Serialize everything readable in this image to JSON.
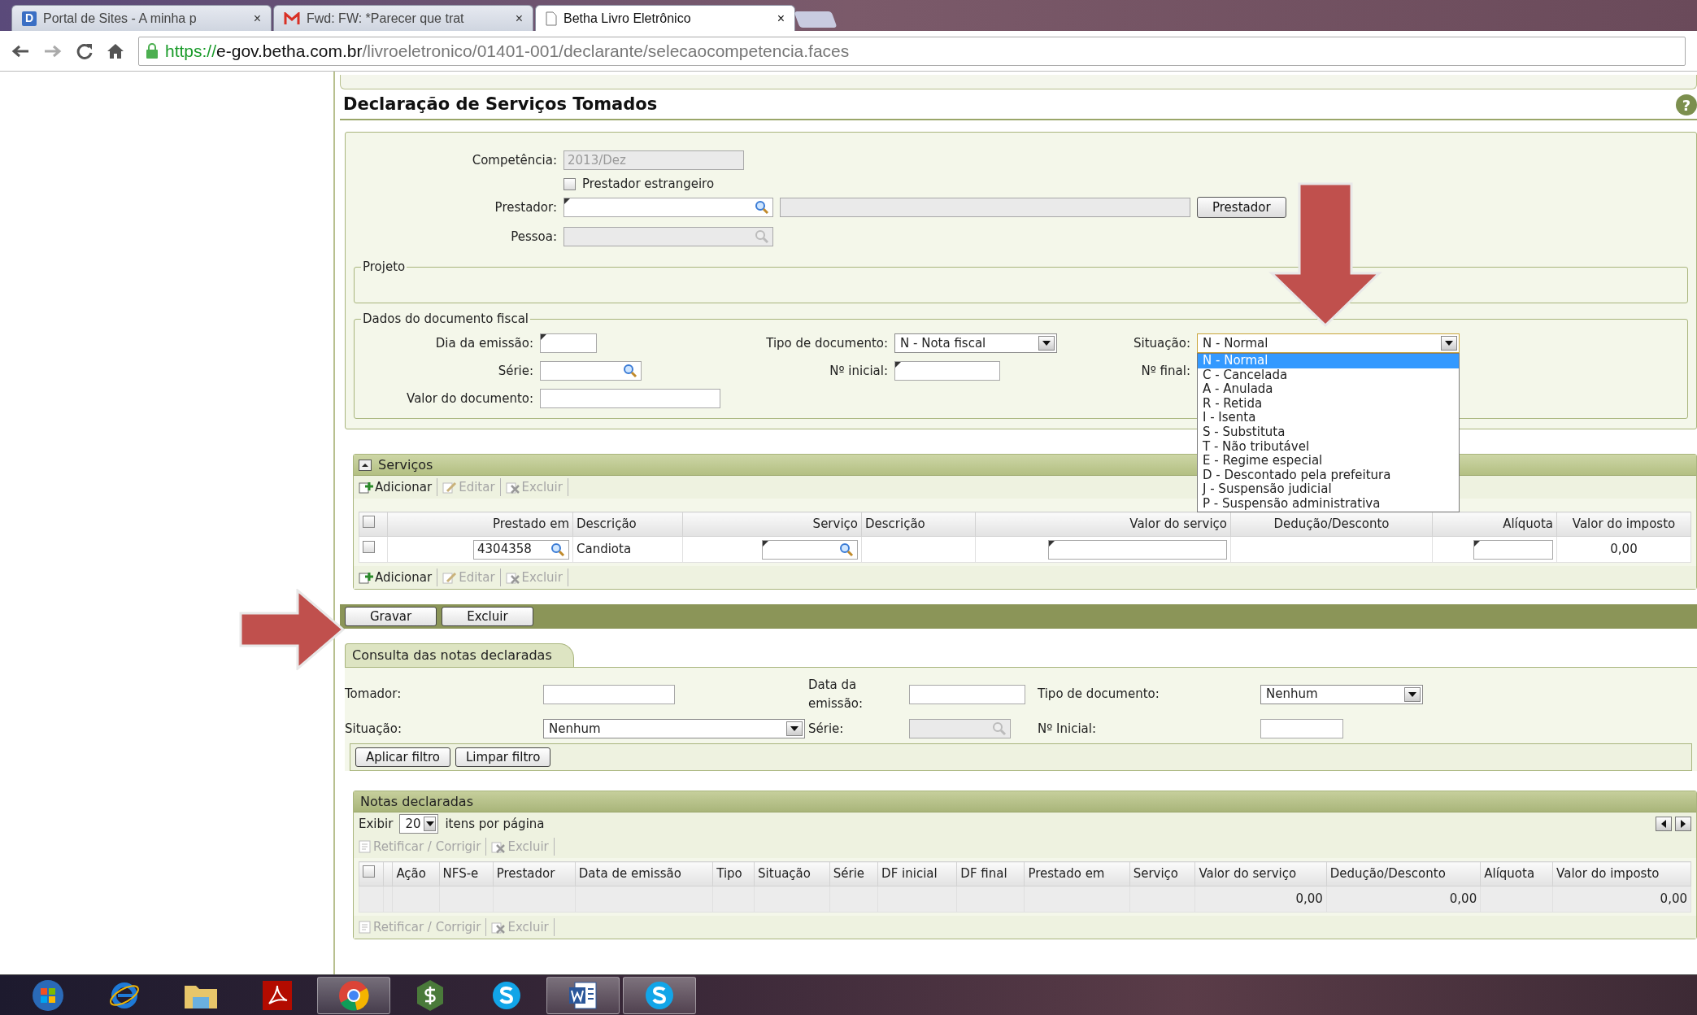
{
  "browser": {
    "tabs": [
      {
        "kind": "portal",
        "badge": "D",
        "title": "Portal de Sites - A minha p",
        "close": "×",
        "selected": false
      },
      {
        "kind": "mail",
        "title": "Fwd: FW: *Parecer que trat",
        "close": "×",
        "selected": false
      },
      {
        "kind": "page",
        "title": "Betha Livro Eletrônico",
        "close": "×",
        "selected": true
      }
    ],
    "url": {
      "scheme": "https://",
      "host": "e-gov.betha.com.br",
      "path": "/livroeletronico/01401-001/declarante/selecaocompetencia.faces"
    }
  },
  "page": {
    "title": "Declaração de Serviços Tomados",
    "help": "?"
  },
  "form": {
    "competencia": {
      "label": "Competência:",
      "value": "2013/Dez",
      "disabled": true
    },
    "estrangeiro": {
      "label": "Prestador estrangeiro",
      "checked": false
    },
    "prestador": {
      "label": "Prestador:",
      "button": "Prestador"
    },
    "pessoa": {
      "label": "Pessoa:",
      "disabled": true
    },
    "projeto": {
      "legend": "Projeto"
    },
    "documento": {
      "legend": "Dados do documento fiscal",
      "dia": {
        "label": "Dia da emissão:"
      },
      "tipo": {
        "label": "Tipo de documento:",
        "value": "N - Nota fiscal"
      },
      "situacao": {
        "label": "Situação:",
        "value": "N - Normal",
        "expanded": true,
        "options": [
          {
            "text": "N - Normal",
            "selected": true
          },
          {
            "text": "C - Cancelada",
            "selected": false
          },
          {
            "text": "A - Anulada",
            "selected": false
          },
          {
            "text": "R - Retida",
            "selected": false
          },
          {
            "text": "I - Isenta",
            "selected": false
          },
          {
            "text": "S - Substituta",
            "selected": false
          },
          {
            "text": "T - Não tributável",
            "selected": false
          },
          {
            "text": "E - Regime especial",
            "selected": false
          },
          {
            "text": "D - Descontado pela prefeitura",
            "selected": false
          },
          {
            "text": "J - Suspensão judicial",
            "selected": false
          },
          {
            "text": "P - Suspensão administrativa",
            "selected": false
          }
        ]
      },
      "serie": {
        "label": "Série:"
      },
      "inicial": {
        "label": "Nº inicial:"
      },
      "final": {
        "label": "Nº final:"
      },
      "valor": {
        "label": "Valor do documento:"
      }
    }
  },
  "servicos": {
    "title": "Serviços",
    "all_checked": false,
    "toolbar": [
      {
        "kind": "add",
        "label": "Adicionar",
        "disabled": false
      },
      {
        "kind": "edit",
        "label": "Editar",
        "disabled": true
      },
      {
        "kind": "delete",
        "label": "Excluir",
        "disabled": true
      }
    ],
    "columns": [
      "Prestado em",
      "Descrição",
      "Serviço",
      "Descrição",
      "Valor do serviço",
      "Dedução/Desconto",
      "Alíquota",
      "Valor do imposto"
    ],
    "rows": [
      {
        "checked": false,
        "prestado_em": "4304358",
        "descricao": "Candiota",
        "valor_imposto": "0,00"
      }
    ],
    "toolbar_bottom": [
      {
        "kind": "add",
        "label": "Adicionar",
        "disabled": false
      },
      {
        "kind": "edit",
        "label": "Editar",
        "disabled": true
      },
      {
        "kind": "delete",
        "label": "Excluir",
        "disabled": true
      }
    ]
  },
  "actions": [
    "Gravar",
    "Excluir"
  ],
  "consulta": {
    "title": "Consulta das notas declaradas",
    "tomador": {
      "label": "Tomador:"
    },
    "data": {
      "label": "Data da emissão:"
    },
    "tipo": {
      "label": "Tipo de documento:",
      "value": "Nenhum"
    },
    "situacao": {
      "label": "Situação:",
      "value": "Nenhum"
    },
    "serie": {
      "label": "Série:",
      "disabled": true
    },
    "inicial": {
      "label": "Nº Inicial:"
    },
    "buttons": [
      "Aplicar filtro",
      "Limpar filtro"
    ]
  },
  "notas": {
    "title": "Notas declaradas",
    "all_checked": false,
    "show_label": "Exibir",
    "page_size": "20",
    "per_page": "itens por página",
    "toolbar": [
      {
        "kind": "fix",
        "label": "Retificar / Corrigir",
        "disabled": true
      },
      {
        "kind": "delete",
        "label": "Excluir",
        "disabled": true
      }
    ],
    "columns": [
      "Ação",
      "NFS-e",
      "Prestador",
      "Data de emissão",
      "Tipo",
      "Situação",
      "Série",
      "DF inicial",
      "DF final",
      "Prestado em",
      "Serviço",
      "Valor do serviço",
      "Dedução/Desconto",
      "Alíquota",
      "Valor do imposto"
    ],
    "totals": {
      "valor_servico": "0,00",
      "deducao": "0,00",
      "valor_imposto": "0,00"
    },
    "toolbar_bottom": [
      {
        "kind": "fix",
        "label": "Retificar / Corrigir",
        "disabled": true
      },
      {
        "kind": "delete",
        "label": "Excluir",
        "disabled": true
      }
    ]
  },
  "taskbar": [
    {
      "kind": "start",
      "selected": false
    },
    {
      "kind": "ie",
      "selected": false
    },
    {
      "kind": "folder",
      "selected": false
    },
    {
      "kind": "pdf",
      "selected": false
    },
    {
      "kind": "chrome",
      "selected": true
    },
    {
      "kind": "money",
      "selected": false
    },
    {
      "kind": "skype",
      "selected": false
    },
    {
      "kind": "word",
      "selected": true
    },
    {
      "kind": "skype",
      "selected": true
    }
  ]
}
